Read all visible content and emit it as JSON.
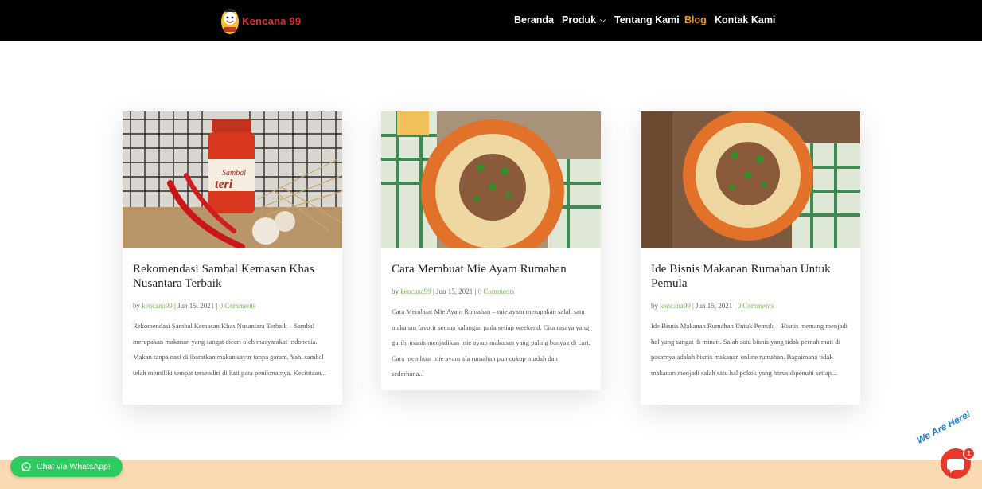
{
  "brand": {
    "name": "Kencana 99"
  },
  "nav": [
    {
      "label": "Beranda",
      "active": false
    },
    {
      "label": "Produk",
      "active": false,
      "dropdown": true
    },
    {
      "label": "Tentang Kami",
      "active": false
    },
    {
      "label": "Blog",
      "active": true
    },
    {
      "label": "Kontak Kami",
      "active": false
    }
  ],
  "posts": [
    {
      "title": "Rekomendasi Sambal Kemasan Khas Nusantara Terbaik",
      "by": "by",
      "author": "kencana99",
      "date": "Jun 15, 2021",
      "comments": "0 Comments",
      "excerpt": "Rekomendasi Sambal Kemasan Khas Nusantara Terbaik – Sambal merupakan makanan yang sangat dicari oleh masyarakat indonesia. Makan tanpa nasi di ibaratkan makan sayur tanpa garam. Yah, sambal telah memiliki tempat tersendiri di hati para penikmatnya.  Kecintaan...",
      "image_text_line1": "Sambal",
      "image_text_line2": "teri"
    },
    {
      "title": "Cara Membuat Mie Ayam Rumahan",
      "by": "by",
      "author": "kencana99",
      "date": "Jun 15, 2021",
      "comments": "0 Comments",
      "excerpt": "Cara Membuat Mie Ayam Rumahan – mie ayam merupakan salah satu makanan favorit semua kalangan pada setiap weekend. Cita rasaya yang gurih, manis menjadikan mie ayam makanan yang paling banyak di cari. Cara membuat mie ayam ala rumahan pun cukup mudah dan sederhana..."
    },
    {
      "title": "Ide Bisnis Makanan Rumahan Untuk Pemula",
      "by": "by",
      "author": "kencana99",
      "date": "Jun 15, 2021",
      "comments": "0 Comments",
      "excerpt": "Ide Bisnis Makanan Rumahan Untuk Pemula – Bisnis memang menjadi hal yang sangat di minati. Salah satu bisnis yang tidak pernah mati di pasarnya adalah bisnis makanan online rumahan. Bagaimana tidak makanan menjadi salah satu hal pokok yang harus dipenuhi setiap..."
    }
  ],
  "whatsapp": {
    "label": "Chat via WhatsApp!"
  },
  "chat": {
    "label": "We Are Here!",
    "badge": "1"
  },
  "colors": {
    "header": "#000000",
    "accent": "#f0952b",
    "link": "#7bb05a",
    "band": "#fbd9b3"
  }
}
